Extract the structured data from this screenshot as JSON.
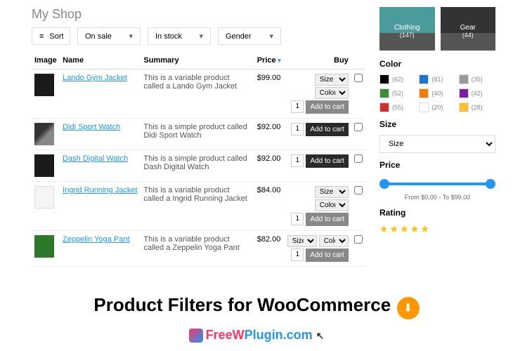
{
  "shop_title": "My Shop",
  "filters": {
    "sort": "Sort",
    "onsale": "On sale",
    "instock": "In stock",
    "gender": "Gender"
  },
  "headers": {
    "image": "Image",
    "name": "Name",
    "summary": "Summary",
    "price": "Price",
    "buy": "Buy"
  },
  "products": [
    {
      "name": "Lando Gym Jacket",
      "summary": "This is a variable product called a Lando Gym Jacket",
      "price": "$99.00",
      "variable": true,
      "img": "black"
    },
    {
      "name": "Didi Sport Watch",
      "summary": "This is a simple product called Didi Sport Watch",
      "price": "$92.00",
      "variable": false,
      "img": "watch"
    },
    {
      "name": "Dash Digital Watch",
      "summary": "This is a simple product called Dash Digital Watch",
      "price": "$92.00",
      "variable": false,
      "img": "black"
    },
    {
      "name": "Ingrid Running Jacket",
      "summary": "This is a variable product called a Ingrid Running Jacket",
      "price": "$84.00",
      "variable": true,
      "img": "white"
    },
    {
      "name": "Zeppelin Yoga Pant",
      "summary": "This is a variable product called a Zeppelin Yoga Pant",
      "price": "$82.00",
      "variable": true,
      "inline": true,
      "img": "green"
    }
  ],
  "buy": {
    "size": "Size",
    "color": "Color",
    "qty": "1",
    "add": "Add to cart"
  },
  "categories": [
    {
      "name": "Clothing",
      "count": "(147)"
    },
    {
      "name": "Gear",
      "count": "(44)"
    }
  ],
  "sidebar": {
    "color_title": "Color",
    "size_title": "Size",
    "size_value": "Size",
    "price_title": "Price",
    "price_range": "From $0.00 - To $99.00",
    "rating_title": "Rating"
  },
  "colors": [
    {
      "cls": "sw-black",
      "count": "(62)"
    },
    {
      "cls": "sw-blue",
      "count": "(81)"
    },
    {
      "cls": "sw-gray",
      "count": "(35)"
    },
    {
      "cls": "sw-green",
      "count": "(52)"
    },
    {
      "cls": "sw-orange",
      "count": "(40)"
    },
    {
      "cls": "sw-purple",
      "count": "(42)"
    },
    {
      "cls": "sw-red",
      "count": "(55)"
    },
    {
      "cls": "sw-white",
      "count": "(20)"
    },
    {
      "cls": "sw-yellow",
      "count": "(28)"
    }
  ],
  "footer": {
    "title": "Product Filters for WooCommerce",
    "brand_free": "Free",
    "brand_w": "W",
    "brand_plugin": "Plugin.com"
  }
}
